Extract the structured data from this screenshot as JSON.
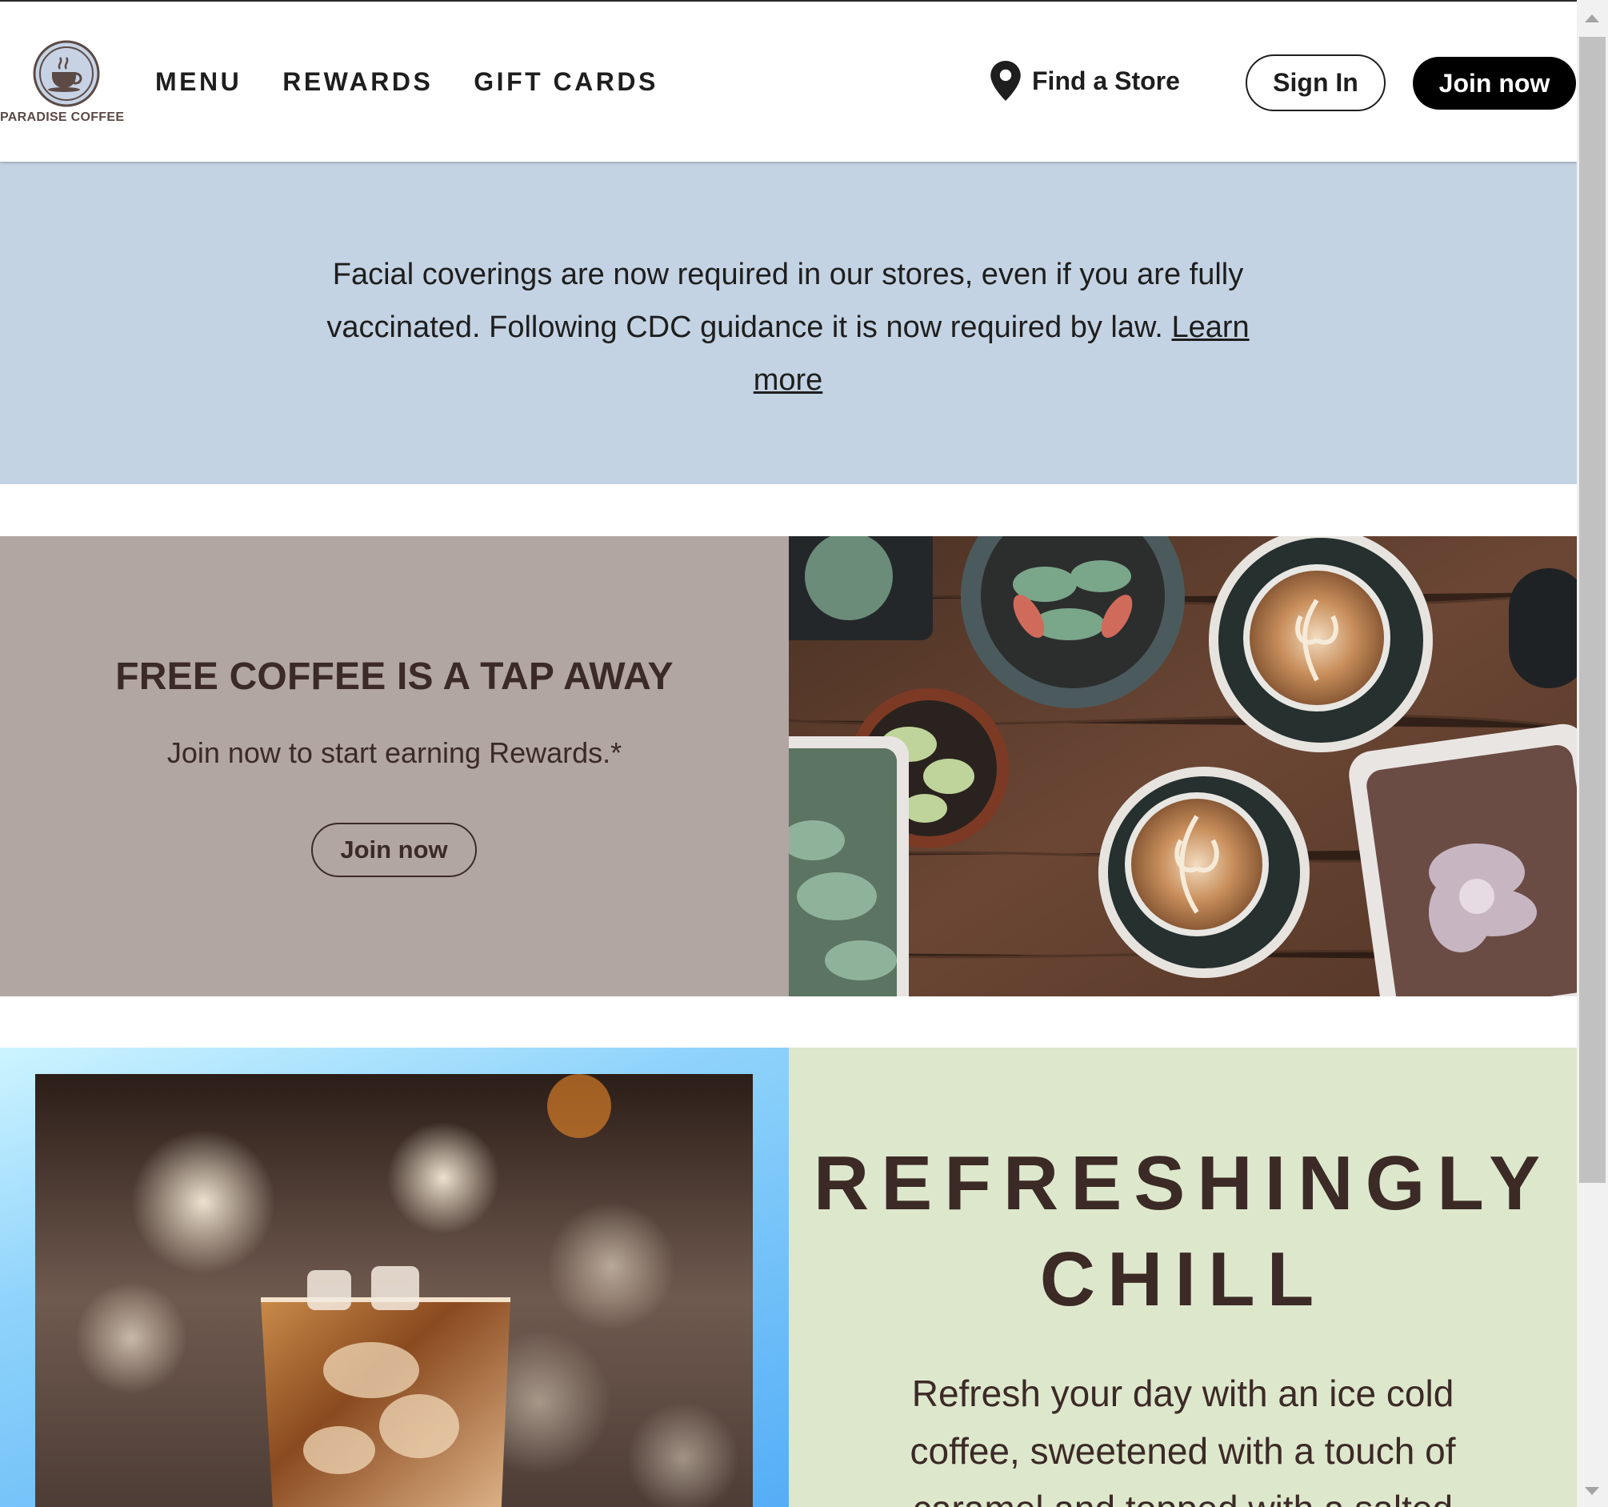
{
  "header": {
    "logo_text": "PARADISE COFFEE",
    "nav": [
      {
        "label": "MENU"
      },
      {
        "label": "REWARDS"
      },
      {
        "label": "GIFT CARDS"
      }
    ],
    "find_store_label": "Find a Store",
    "find_store_icon": "location-pin-icon",
    "sign_in_label": "Sign In",
    "join_label": "Join now"
  },
  "notice": {
    "text": "Facial coverings are now required in our stores, even if you are fully vaccinated. Following CDC guidance it is now required by law.",
    "link_label": "Learn more",
    "background": "#c4d3e3"
  },
  "promo": {
    "title": "FREE COFFEE IS A TAP AWAY",
    "subtitle": "Join now to start earning Rewards.*",
    "button_label": "Join now",
    "background": "#b1a6a2",
    "image": "coffee-cups-and-succulents-photo"
  },
  "chill": {
    "title_line1": "REFRESHINGLY",
    "title_line2": "CHILL",
    "body": "Refresh your day with an ice cold coffee, sweetened with a touch of caramel and topped with a salted",
    "background": "#dde7cc",
    "image": "iced-coffee-glass-photo"
  },
  "colors": {
    "text_dark": "#1e1e1e",
    "text_brown": "#3b2a26",
    "button_black": "#000000"
  }
}
